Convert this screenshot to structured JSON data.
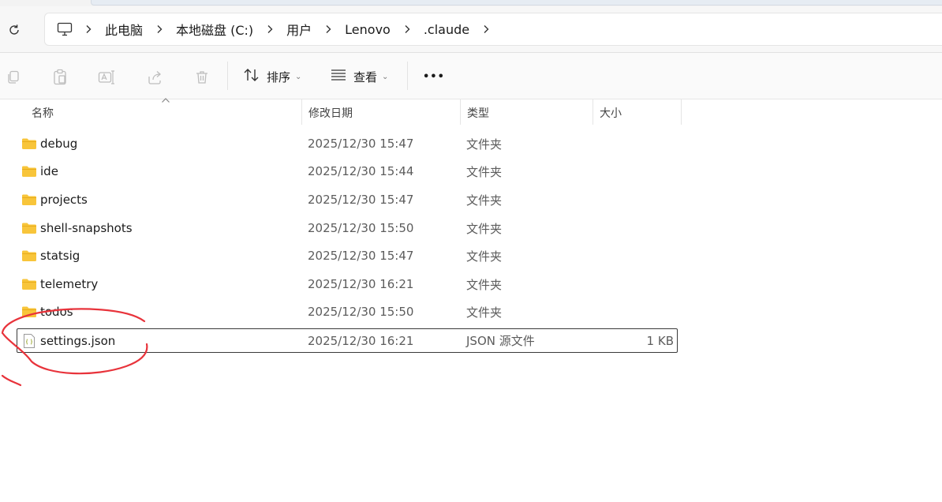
{
  "address": {
    "breadcrumbs": [
      "此电脑",
      "本地磁盘 (C:)",
      "用户",
      "Lenovo",
      ".claude"
    ]
  },
  "toolbar": {
    "sort_label": "排序",
    "view_label": "查看",
    "more_label": "•••"
  },
  "columns": {
    "name": "名称",
    "date": "修改日期",
    "type": "类型",
    "size": "大小"
  },
  "files": [
    {
      "name": "debug",
      "date": "2025/12/30 15:47",
      "type": "文件夹",
      "size": "",
      "icon": "folder-icon"
    },
    {
      "name": "ide",
      "date": "2025/12/30 15:44",
      "type": "文件夹",
      "size": "",
      "icon": "folder-icon"
    },
    {
      "name": "projects",
      "date": "2025/12/30 15:47",
      "type": "文件夹",
      "size": "",
      "icon": "folder-icon"
    },
    {
      "name": "shell-snapshots",
      "date": "2025/12/30 15:50",
      "type": "文件夹",
      "size": "",
      "icon": "folder-icon"
    },
    {
      "name": "statsig",
      "date": "2025/12/30 15:47",
      "type": "文件夹",
      "size": "",
      "icon": "folder-icon"
    },
    {
      "name": "telemetry",
      "date": "2025/12/30 16:21",
      "type": "文件夹",
      "size": "",
      "icon": "folder-icon"
    },
    {
      "name": "todos",
      "date": "2025/12/30 15:50",
      "type": "文件夹",
      "size": "",
      "icon": "folder-icon"
    },
    {
      "name": "settings.json",
      "date": "2025/12/30 16:21",
      "type": "JSON 源文件",
      "size": "1 KB",
      "icon": "json-file-icon"
    }
  ],
  "colors": {
    "folder": "#f8c53a",
    "annotation": "#e8333b"
  }
}
